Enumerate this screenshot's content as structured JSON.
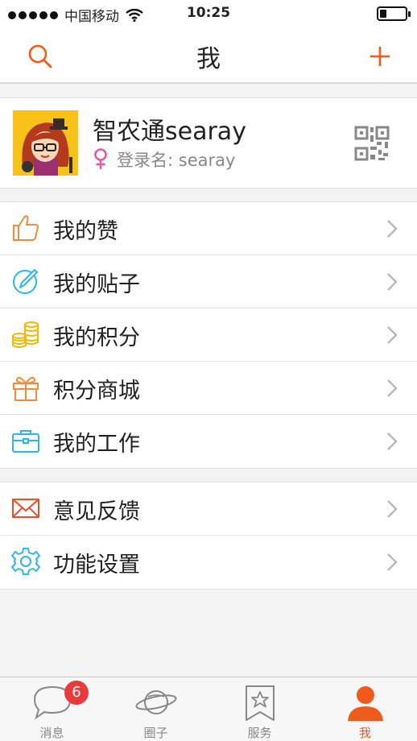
{
  "status_bar": {
    "carrier": "中国移动",
    "time": "10:25",
    "battery_level": 0.25
  },
  "nav": {
    "title": "我",
    "left_icon": "search-icon",
    "right_icon": "plus-icon"
  },
  "profile": {
    "name": "智农通searay",
    "login_label": "登录名: searay",
    "gender_icon": "female-icon",
    "qr_icon": "qr-code-icon"
  },
  "menu_group_1": [
    {
      "label": "我的赞",
      "icon": "thumbs-up-icon"
    },
    {
      "label": "我的贴子",
      "icon": "pen-circle-icon"
    },
    {
      "label": "我的积分",
      "icon": "coins-icon"
    },
    {
      "label": "积分商城",
      "icon": "gift-icon"
    },
    {
      "label": "我的工作",
      "icon": "briefcase-icon"
    }
  ],
  "menu_group_2": [
    {
      "label": "意见反馈",
      "icon": "envelope-icon"
    },
    {
      "label": "功能设置",
      "icon": "gear-icon"
    }
  ],
  "tabs": [
    {
      "label": "消息",
      "icon": "chat-bubble-icon",
      "badge": "6"
    },
    {
      "label": "圈子",
      "icon": "planet-icon"
    },
    {
      "label": "服务",
      "icon": "star-bookmark-icon"
    },
    {
      "label": "我",
      "icon": "person-icon",
      "active": true
    }
  ],
  "colors": {
    "accent": "#f05a1a",
    "badge": "#e93b3b",
    "blue": "#2db7e6",
    "yellow": "#f5b800",
    "red": "#e8502e"
  }
}
